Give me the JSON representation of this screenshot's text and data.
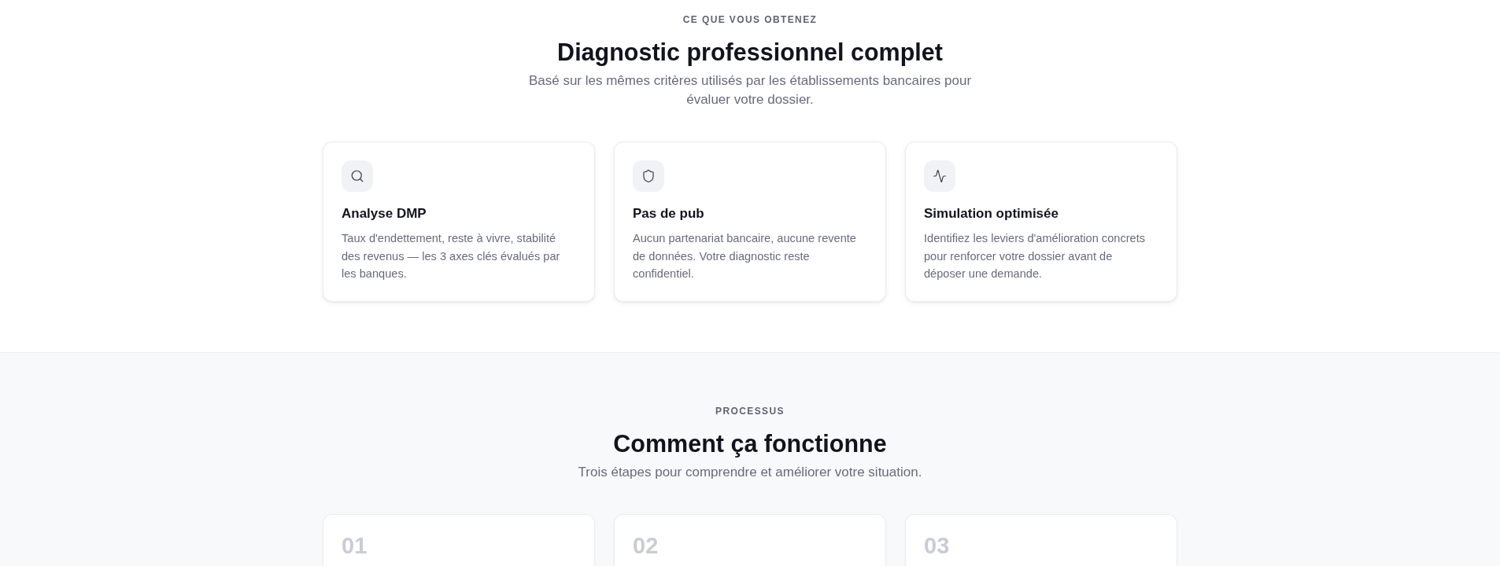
{
  "features_section": {
    "eyebrow": "CE QUE VOUS OBTENEZ",
    "heading": "Diagnostic professionnel complet",
    "subtitle": "Basé sur les mêmes critères utilisés par les établissements bancaires pour évaluer votre dossier.",
    "cards": [
      {
        "title": "Analyse DMP",
        "description": "Taux d'endettement, reste à vivre, stabilité des revenus — les 3 axes clés évalués par les banques."
      },
      {
        "title": "Pas de pub",
        "description": "Aucun partenariat bancaire, aucune revente de données. Votre diagnostic reste confidentiel."
      },
      {
        "title": "Simulation optimisée",
        "description": "Identifiez les leviers d'amélioration concrets pour renforcer votre dossier avant de déposer une demande."
      }
    ]
  },
  "process_section": {
    "eyebrow": "PROCESSUS",
    "heading": "Comment ça fonctionne",
    "subtitle": "Trois étapes pour comprendre et améliorer votre situation.",
    "steps": [
      {
        "number": "01"
      },
      {
        "number": "02"
      },
      {
        "number": "03"
      }
    ]
  }
}
